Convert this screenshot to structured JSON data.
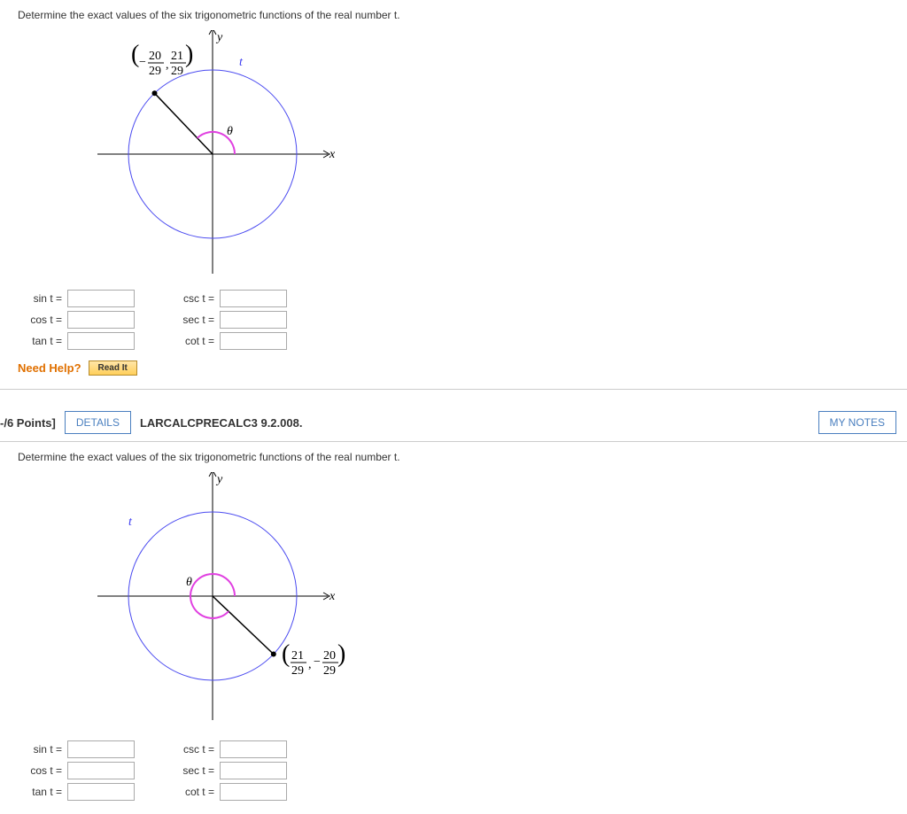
{
  "q1": {
    "text": "Determine the exact values of the six trigonometric functions of the real number t.",
    "y_label": "y",
    "x_label": "x",
    "t_label": "t",
    "theta_label": "θ",
    "point_num1": "20",
    "point_num2": "21",
    "point_den": "29",
    "labels": {
      "sin": "sin t =",
      "cos": "cos t =",
      "tan": "tan t =",
      "csc": "csc t =",
      "sec": "sec t =",
      "cot": "cot t ="
    },
    "need_help": "Need Help?",
    "read_it": "Read It"
  },
  "header": {
    "points": "-/6 Points]",
    "details": "DETAILS",
    "problem_id": "LARCALCPRECALC3 9.2.008.",
    "my_notes": "MY NOTES"
  },
  "q2": {
    "text": "Determine the exact values of the six trigonometric functions of the real number t.",
    "y_label": "y",
    "x_label": "x",
    "t_label": "t",
    "theta_label": "θ",
    "point_num1": "21",
    "point_num2": "20",
    "point_den": "29",
    "labels": {
      "sin": "sin t =",
      "cos": "cos t =",
      "tan": "tan t =",
      "csc": "csc t =",
      "sec": "sec t =",
      "cot": "cot t ="
    }
  }
}
